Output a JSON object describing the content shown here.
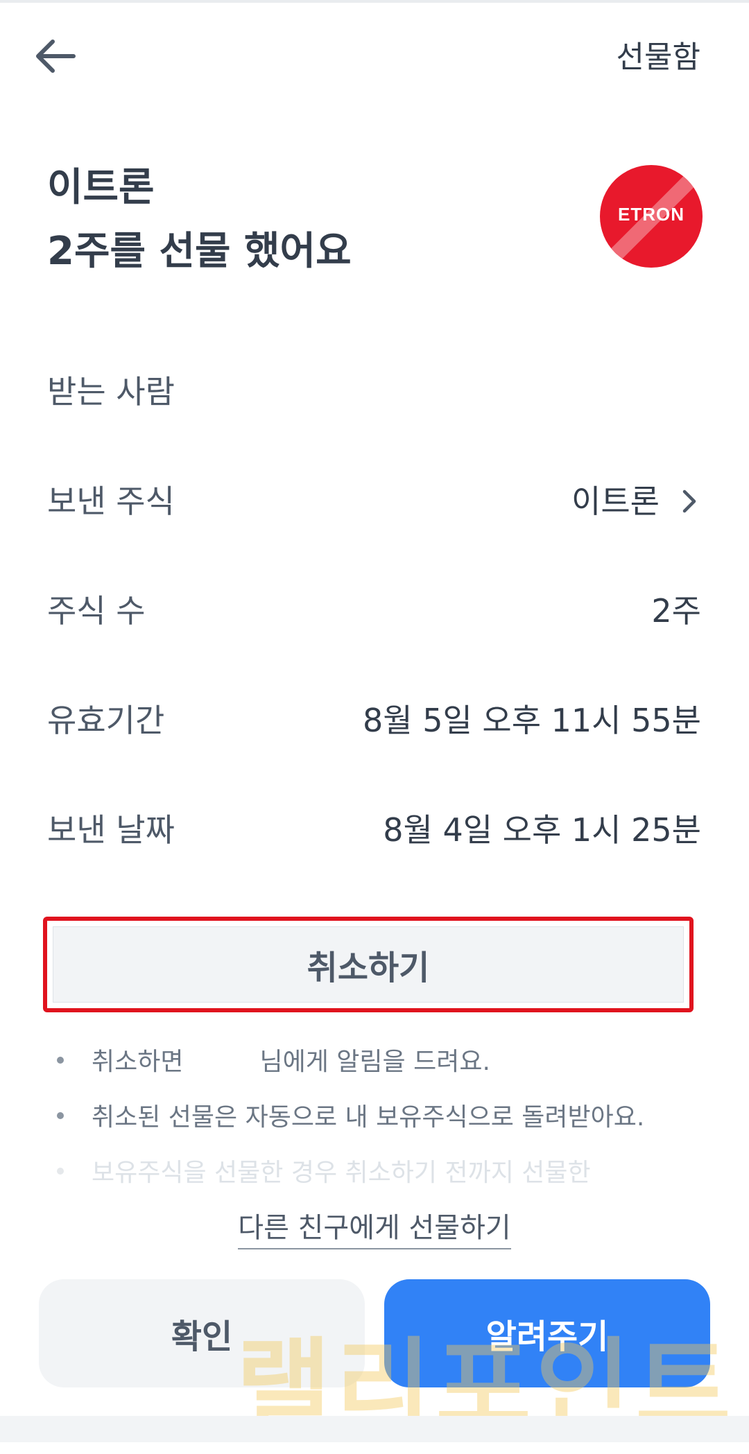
{
  "header": {
    "back_icon": "arrow-left-icon",
    "gift_box_label": "선물함"
  },
  "hero": {
    "stock_name": "이트론",
    "message": "2주를 선물 했어요",
    "logo_text": "ETRON",
    "logo_color": "#e8192c"
  },
  "details": {
    "recipient_label": "받는 사람",
    "stock_label": "보낸 주식",
    "stock_value": "이트론",
    "shares_label": "주식 수",
    "shares_value": "2주",
    "expiry_label": "유효기간",
    "expiry_value": "8월 5일 오후 11시 55분",
    "sent_label": "보낸 날짜",
    "sent_value": "8월 4일 오후 1시 25분"
  },
  "cancel_button": "취소하기",
  "notes": {
    "n1_prefix": "취소하면",
    "n1_suffix": "님에게 알림을 드려요.",
    "n2": "취소된 선물은 자동으로 내 보유주식으로 돌려받아요.",
    "n3": "보유주식을 선물한 경우 취소하기 전까지 선물한"
  },
  "other_friend_link": "다른 친구에게 선물하기",
  "buttons": {
    "confirm": "확인",
    "notify": "알려주기"
  },
  "watermark": "랠리포인트",
  "colors": {
    "primary": "#3182f6",
    "highlight": "#e0131e",
    "text": "#333d4b"
  }
}
